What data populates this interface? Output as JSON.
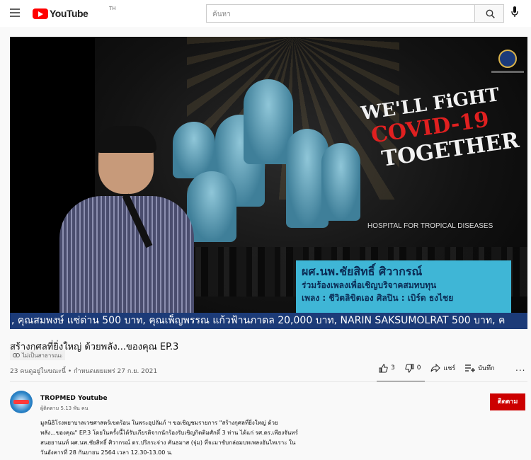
{
  "header": {
    "logo_text": "YouTube",
    "logo_region": "TH",
    "search_placeholder": "ค้นหา"
  },
  "player": {
    "title_art": [
      "WE'LL FiGHT",
      "COVID-19",
      "TOGETHER"
    ],
    "title_art_sub": "HOSPITAL FOR TROPICAL DISEASES",
    "caption_name": "ผศ.นพ.ชัยสิทธิ์ ศิวากรณ์",
    "caption_line2": "ร่วมร้องเพลงเพื่อเชิญบริจาคสมทบทุน",
    "caption_line3": "เพลง : ชีวิตลิขิตเอง   ศิลปิน : เบิร์ด ธงไชย",
    "ticker": ", คุณสมพงษ์ แซ่ด่าน 500 บาท, คุณเพ็ญพรรณ แก้วฟ้านภาดล 20,000 บาท, NARIN SAKSUMOLRAT 500 บาท, ค"
  },
  "video": {
    "title": "สร้างกุศลที่ยิ่งใหญ่ ด้วยพลัง...ของคุณ EP.3",
    "privacy": "ไม่เป็นสาธารณะ",
    "stats": "23 คนดูอยู่ในขณะนี้ • กำหนดเผยแพร่ 27 ก.ย. 2021",
    "likes": "3",
    "dislikes": "0",
    "share_label": "แชร์",
    "save_label": "บันทึก",
    "more_label": "..."
  },
  "channel": {
    "name": "TROPMED Youtube",
    "subscribers": "ผู้ติดตาม 5.13 พัน คน",
    "subscribe_label": "ติดตาม"
  },
  "description": [
    "มูลนิธิโรงพยาบาลเวชศาสตร์เขตร้อน ในพระอุปถัมภ์ ฯ ขอเชิญชมรายการ \"สร้างกุศลที่ยิ่งใหญ่ ด้วย",
    "พลัง...ของคุณ\" EP.3 โดยในครั้งนี้ได้รับเกียรติจากนักร้องรับเชิญกิตติมศักดิ์ 3 ท่าน ได้แก่ รศ.ดร.เพียงจันทร์",
    "สนยยานนท์ ผศ.นพ.ชัยสิทธิ์ ศิวากรณ์ ดร.ปริกระจ่าง คันธมาส (จุ่ม) ที่จะมาขับกล่อมบทเพลงอันไพเราะ ใน",
    "วันอังคารที่ 28 กันยายน 2564 เวลา 12.30-13.00 น."
  ],
  "colors": {
    "brand_red": "#ff0000",
    "subscribe_red": "#cc0000",
    "caption_bg": "#3fb6d6",
    "ticker_bg": "#1c3b78",
    "title_red": "#e02020"
  },
  "icons": [
    "menu-icon",
    "youtube-logo-icon",
    "search-icon",
    "mic-icon",
    "like-icon",
    "dislike-icon",
    "share-icon",
    "save-playlist-icon",
    "link-icon"
  ]
}
